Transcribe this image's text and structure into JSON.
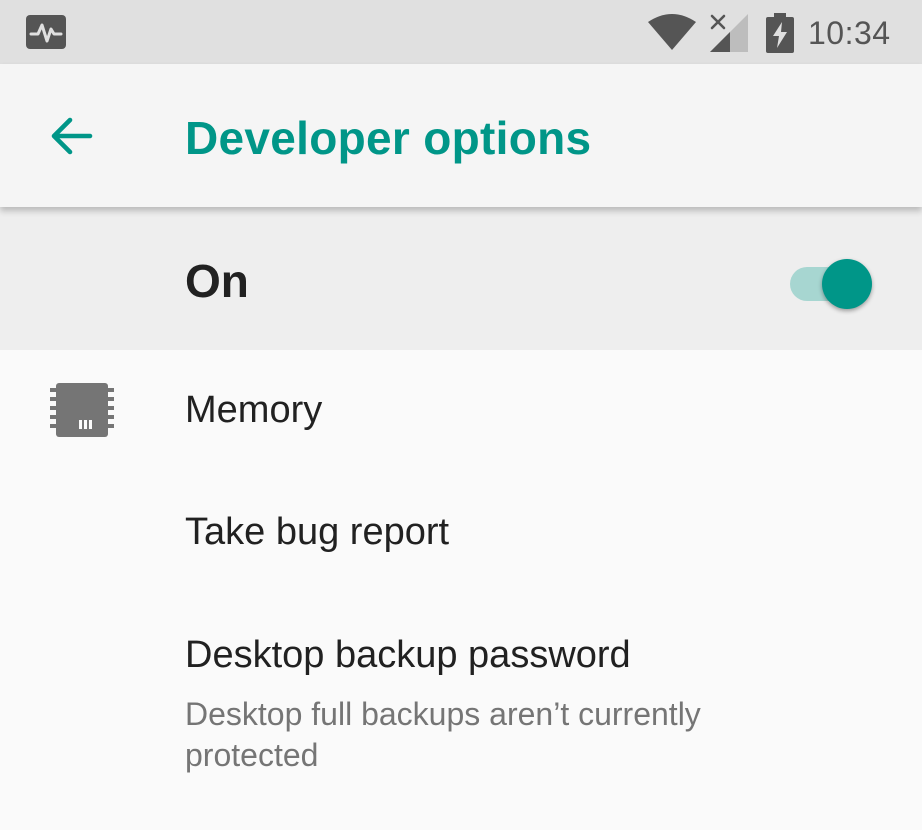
{
  "status_bar": {
    "time": "10:34",
    "icons": [
      "pulse-icon",
      "wifi-icon",
      "no-signal-icon",
      "battery-charging-icon"
    ]
  },
  "app_bar": {
    "title": "Developer options",
    "back_icon": "arrow-back-icon"
  },
  "master_switch": {
    "label": "On",
    "checked": true
  },
  "preferences": [
    {
      "title": "Memory",
      "summary": "",
      "icon": "memory-chip-icon"
    },
    {
      "title": "Take bug report",
      "summary": ""
    },
    {
      "title": "Desktop backup password",
      "summary": "Desktop full backups aren’t currently protected"
    }
  ],
  "colors": {
    "accent": "#009688",
    "accent_track": "#a7d6d1",
    "status_bar_bg": "#e0e0e0",
    "app_bar_bg": "#f5f5f5",
    "master_row_bg": "#eeeeee",
    "page_bg": "#fafafa",
    "text_primary": "#212121",
    "text_secondary": "#757575"
  }
}
